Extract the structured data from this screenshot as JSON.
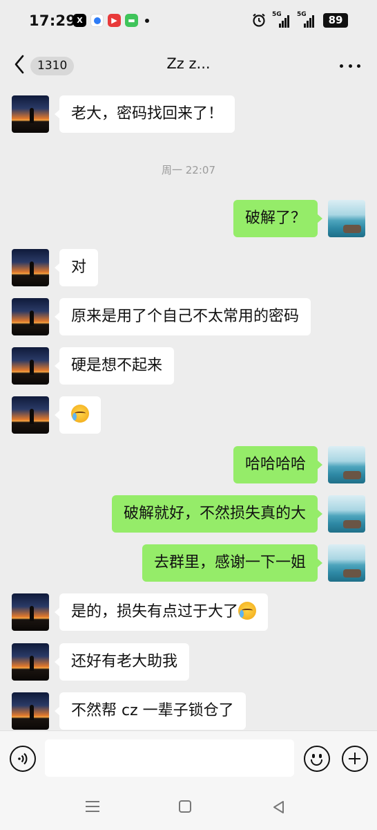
{
  "status_bar": {
    "time": "17:29",
    "network_1": "5G",
    "network_2": "5G",
    "battery": "89",
    "icons": [
      "x-app-icon",
      "blue-app-icon",
      "video-app-icon",
      "message-app-icon",
      "alarm-icon"
    ]
  },
  "header": {
    "back_icon": "chevron-left-icon",
    "unread_count": "1310",
    "title": "Zz z...",
    "more_icon": "more-dots-icon"
  },
  "messages": [
    {
      "side": "in",
      "text": "老大，密码找回来了！"
    },
    {
      "type": "time",
      "text": "周一 22:07"
    },
    {
      "side": "out",
      "text": "破解了？"
    },
    {
      "side": "in",
      "text": "对"
    },
    {
      "side": "in",
      "text": "原来是用了个自己不太常用的密码"
    },
    {
      "side": "in",
      "text": "硬是想不起来"
    },
    {
      "side": "in",
      "text": "",
      "emoji": "crying-laughing-emoji"
    },
    {
      "side": "out",
      "text": "哈哈哈哈"
    },
    {
      "side": "out",
      "text": "破解就好，不然损失真的大"
    },
    {
      "side": "out",
      "text": "去群里，感谢一下一姐"
    },
    {
      "side": "in",
      "text": "是的，损失有点过于大了",
      "emoji": "crying-laughing-emoji"
    },
    {
      "side": "in",
      "text": "还好有老大助我"
    },
    {
      "side": "in",
      "text": "不然帮 cz 一辈子锁仓了"
    }
  ],
  "input_bar": {
    "voice_icon": "voice-icon",
    "placeholder": "",
    "emoji_icon": "emoji-icon",
    "plus_icon": "plus-icon"
  },
  "colors": {
    "background": "#ededed",
    "bubble_in": "#ffffff",
    "bubble_out": "#95ec69"
  }
}
